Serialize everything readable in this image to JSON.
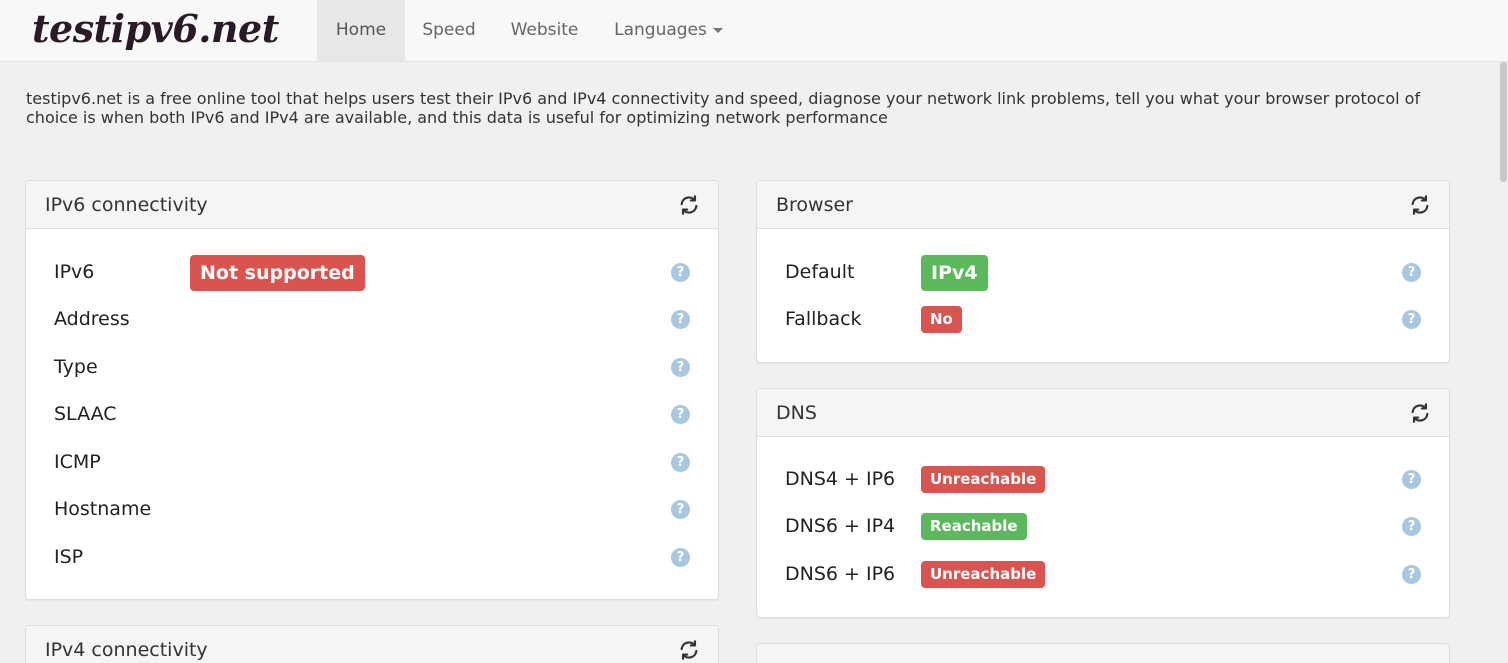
{
  "brand": "testipv6.net",
  "nav": {
    "items": [
      {
        "label": "Home",
        "active": true
      },
      {
        "label": "Speed"
      },
      {
        "label": "Website"
      },
      {
        "label": "Languages"
      }
    ]
  },
  "intro": "testipv6.net is a free online tool that helps users test their IPv6 and IPv4 connectivity and speed, diagnose your network link problems, tell you what your browser protocol of choice is when both IPv6 and IPv4 are available, and this data is useful for optimizing network performance",
  "ipv6_panel": {
    "title": "IPv6 connectivity",
    "rows": [
      {
        "label": "IPv6",
        "value": "Not supported",
        "status": "red"
      },
      {
        "label": "Address"
      },
      {
        "label": "Type"
      },
      {
        "label": "SLAAC"
      },
      {
        "label": "ICMP"
      },
      {
        "label": "Hostname"
      },
      {
        "label": "ISP"
      }
    ]
  },
  "browser_panel": {
    "title": "Browser",
    "rows": [
      {
        "label": "Default",
        "value": "IPv4",
        "status": "green"
      },
      {
        "label": "Fallback",
        "value": "No",
        "status": "red"
      }
    ]
  },
  "dns_panel": {
    "title": "DNS",
    "rows": [
      {
        "label": "DNS4 + IP6",
        "value": "Unreachable",
        "status": "red"
      },
      {
        "label": "DNS6 + IP4",
        "value": "Reachable",
        "status": "green"
      },
      {
        "label": "DNS6 + IP6",
        "value": "Unreachable",
        "status": "red"
      }
    ]
  },
  "ipv4_panel": {
    "title": "IPv4 connectivity"
  },
  "colors": {
    "red": "#d9534f",
    "green": "#5cb85c",
    "help": "#a8c7e0"
  },
  "icons": {
    "refresh": "refresh-icon",
    "help": "question-circle-icon"
  },
  "help_glyph": "?"
}
